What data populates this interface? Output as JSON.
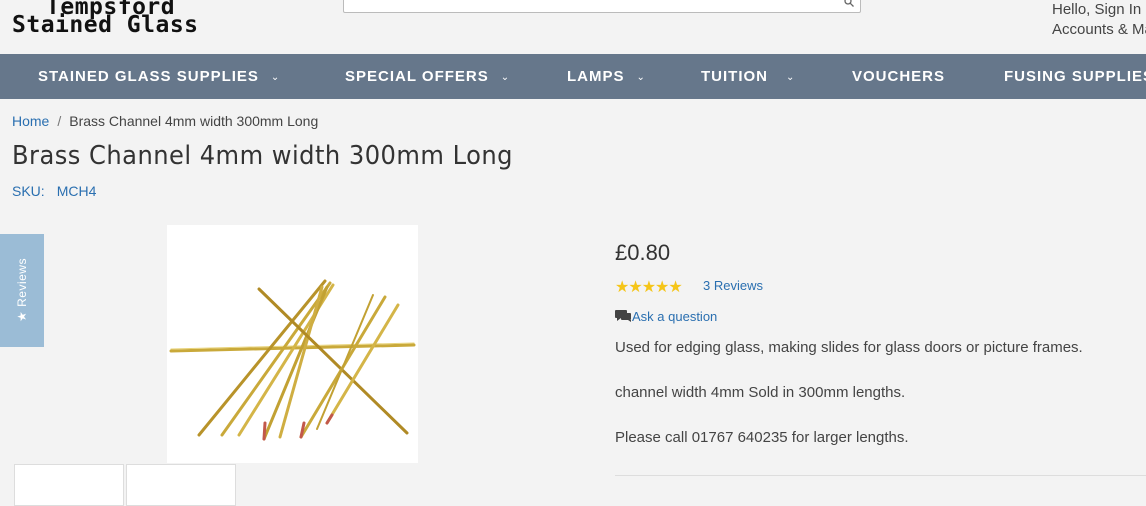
{
  "logo": {
    "line1": "Tempsford",
    "line2": "Stained Glass"
  },
  "account": {
    "line1": "Hello, Sign In",
    "line2": "Accounts & Max"
  },
  "nav": {
    "items": [
      {
        "label": "STAINED GLASS SUPPLIES",
        "has_dropdown": true
      },
      {
        "label": "SPECIAL OFFERS",
        "has_dropdown": true
      },
      {
        "label": "LAMPS",
        "has_dropdown": true
      },
      {
        "label": "TUITION",
        "has_dropdown": true
      },
      {
        "label": "VOUCHERS",
        "has_dropdown": false
      },
      {
        "label": "FUSING SUPPLIES",
        "has_dropdown": false
      }
    ]
  },
  "breadcrumb": {
    "home": "Home",
    "separator": "/",
    "current": "Brass Channel 4mm width 300mm Long"
  },
  "product": {
    "title": "Brass Channel 4mm width 300mm Long",
    "sku_label": "SKU:",
    "sku": "MCH4",
    "price": "£0.80",
    "stars": "★★★★★",
    "rating": 5,
    "reviews": "3 Reviews",
    "ask": "Ask a question",
    "description": [
      "Used for edging glass, making slides for glass doors or picture frames.",
      "channel width 4mm Sold in 300mm lengths.",
      "Please call 01767 640235 for larger lengths."
    ]
  },
  "reviews_tab": "★ Reviews",
  "colors": {
    "nav_bg": "#66778b",
    "link": "#2a6fb0",
    "star": "#f5c518",
    "reviews_tab": "#9bbcd6"
  },
  "icons": {
    "search": "search-icon",
    "chevron": "chevron-down-icon",
    "chat": "chat-bubble-icon",
    "star": "star-icon"
  }
}
